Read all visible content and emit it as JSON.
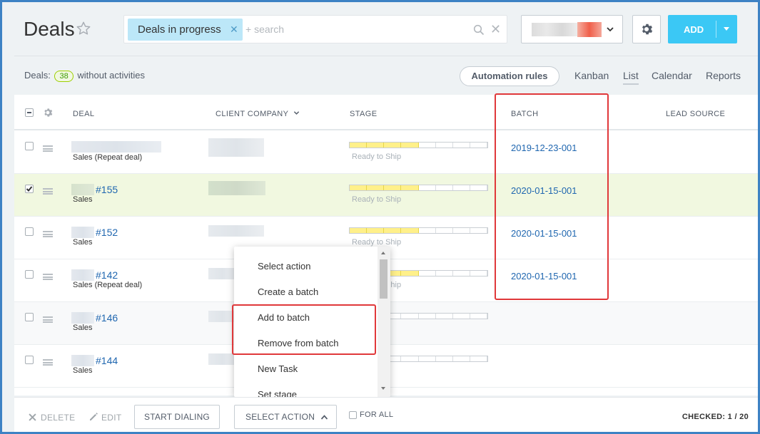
{
  "header": {
    "title": "Deals",
    "filter_chip": "Deals in progress",
    "search_placeholder": "+ search",
    "add_label": "ADD"
  },
  "stats": {
    "label": "Deals:",
    "count": "38",
    "suffix": "without activities"
  },
  "toolbar": {
    "automation_rules": "Automation rules",
    "views": [
      "Kanban",
      "List",
      "Calendar",
      "Reports"
    ],
    "active_view": "List"
  },
  "columns": {
    "deal": "DEAL",
    "client_company": "CLIENT COMPANY",
    "stage": "STAGE",
    "batch": "BATCH",
    "lead_source": "LEAD SOURCE"
  },
  "rows": [
    {
      "deal_no": "",
      "type": "Sales (Repeat deal)",
      "stage": "Ready to Ship",
      "stage_filled": 4,
      "batch": "2019-12-23-001",
      "checked": false
    },
    {
      "deal_no": "#155",
      "type": "Sales",
      "stage": "Ready to Ship",
      "stage_filled": 4,
      "batch": "2020-01-15-001",
      "checked": true
    },
    {
      "deal_no": "#152",
      "type": "Sales",
      "stage": "Ready to Ship",
      "stage_filled": 4,
      "batch": "2020-01-15-001",
      "checked": false
    },
    {
      "deal_no": "#142",
      "type": "Sales (Repeat deal)",
      "stage": "Ready to Ship",
      "stage_filled": 4,
      "batch": "2020-01-15-001",
      "checked": false
    },
    {
      "deal_no": "#146",
      "type": "Sales",
      "stage": "",
      "stage_filled": 0,
      "batch": "",
      "checked": false
    },
    {
      "deal_no": "#144",
      "type": "Sales",
      "stage": "",
      "stage_filled": 0,
      "batch": "",
      "checked": false
    }
  ],
  "action_menu": {
    "items": [
      "Select action",
      "Create a batch",
      "Add to batch",
      "Remove from batch",
      "New Task",
      "Set stage"
    ]
  },
  "bottom_panel": {
    "delete": "DELETE",
    "edit": "EDIT",
    "start_dialing": "START DIALING",
    "select_action": "SELECT ACTION",
    "for_all": "FOR ALL",
    "checked": "CHECKED: 1 / 20"
  },
  "colors": {
    "accent": "#3bc8f5",
    "highlight": "#e0383a",
    "link": "#2067b0",
    "stage_fill": "#fff08a"
  }
}
